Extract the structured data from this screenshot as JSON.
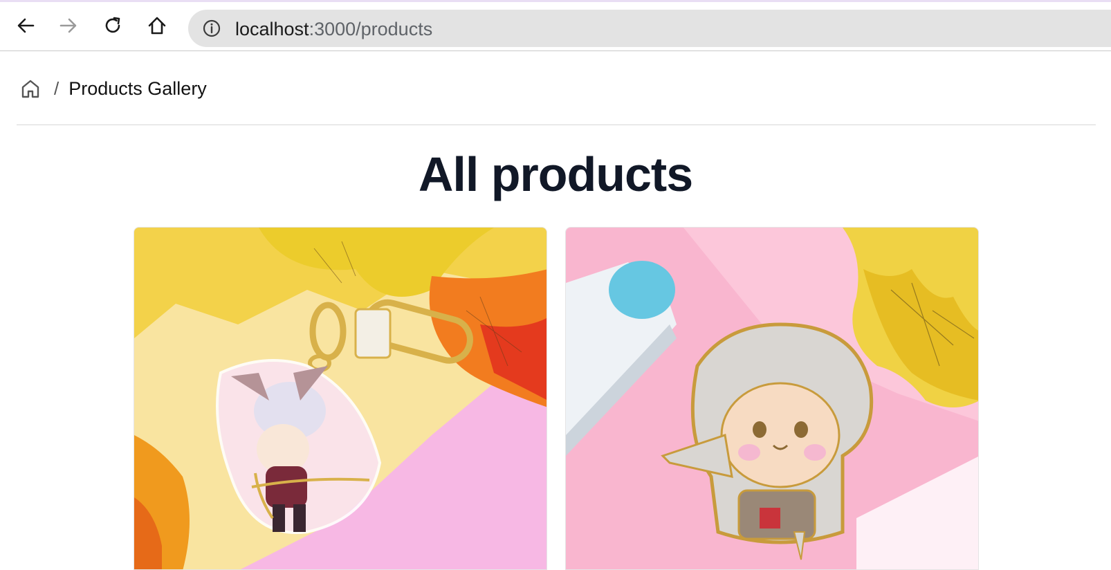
{
  "browser": {
    "url_host": "localhost",
    "url_path": ":3000/products",
    "icons": [
      "back-arrow-icon",
      "forward-arrow-icon",
      "reload-icon",
      "home-icon",
      "site-info-icon"
    ]
  },
  "breadcrumb": {
    "home_icon": "home-outline-icon",
    "separator": "/",
    "current": "Products Gallery"
  },
  "main": {
    "title": "All products",
    "products": [
      {
        "image_alt": "Acrylic keychain of a hooded cat archer on pink background with autumn leaves"
      },
      {
        "image_alt": "Enamel pin of a hooded assassin cat on pink background with autumn leaves"
      }
    ]
  },
  "colors": {
    "title": "#111827",
    "urlbar": "#e3e3e3",
    "divider": "#d6d6d6"
  }
}
